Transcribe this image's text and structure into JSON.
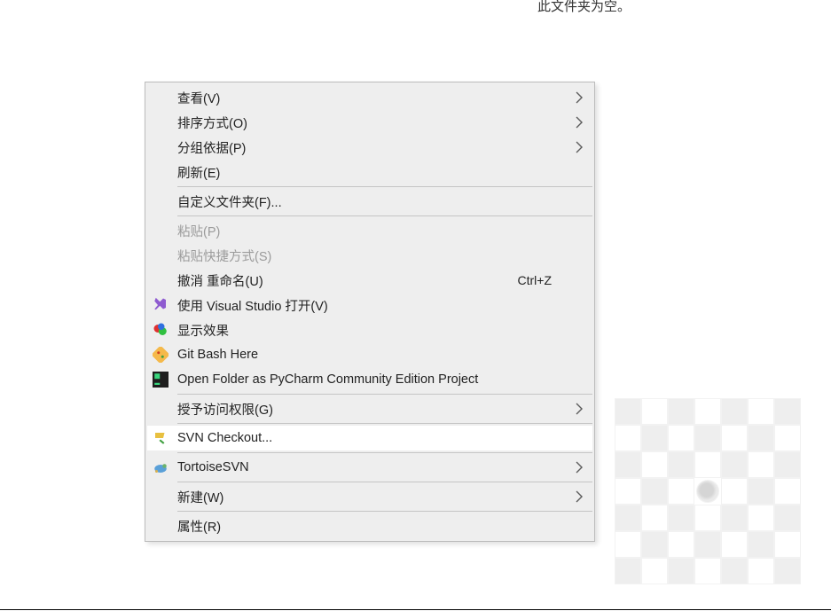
{
  "stray_text": "此文件夹为空。",
  "menu": {
    "items": [
      {
        "label": "查看(V)",
        "icon": null,
        "submenu": true
      },
      {
        "label": "排序方式(O)",
        "icon": null,
        "submenu": true
      },
      {
        "label": "分组依据(P)",
        "icon": null,
        "submenu": true
      },
      {
        "label": "刷新(E)",
        "icon": null
      },
      {
        "separator": true
      },
      {
        "label": "自定义文件夹(F)...",
        "icon": null
      },
      {
        "separator": true
      },
      {
        "label": "粘贴(P)",
        "icon": null,
        "disabled": true
      },
      {
        "label": "粘贴快捷方式(S)",
        "icon": null,
        "disabled": true
      },
      {
        "label": "撤消 重命名(U)",
        "icon": null,
        "accelerator": "Ctrl+Z"
      },
      {
        "label": "使用 Visual Studio 打开(V)",
        "icon": "visualstudio"
      },
      {
        "label": "显示效果",
        "icon": "displayfx"
      },
      {
        "label": "Git Bash Here",
        "icon": "gitbash"
      },
      {
        "label": "Open Folder as PyCharm Community Edition Project",
        "icon": "pycharm"
      },
      {
        "separator": true
      },
      {
        "label": "授予访问权限(G)",
        "icon": null,
        "submenu": true
      },
      {
        "separator": true
      },
      {
        "label": "SVN Checkout...",
        "icon": "svncheckout",
        "highlight": true
      },
      {
        "separator": true
      },
      {
        "label": "TortoiseSVN",
        "icon": "tortoisesvn",
        "submenu": true
      },
      {
        "separator": true
      },
      {
        "label": "新建(W)",
        "icon": null,
        "submenu": true
      },
      {
        "separator": true
      },
      {
        "label": "属性(R)",
        "icon": null
      }
    ]
  },
  "icon_semantics": {
    "visualstudio": "visual-studio-icon",
    "displayfx": "display-effects-icon",
    "gitbash": "git-bash-icon",
    "pycharm": "pycharm-icon",
    "svncheckout": "svn-checkout-icon",
    "tortoisesvn": "tortoise-svn-icon"
  }
}
